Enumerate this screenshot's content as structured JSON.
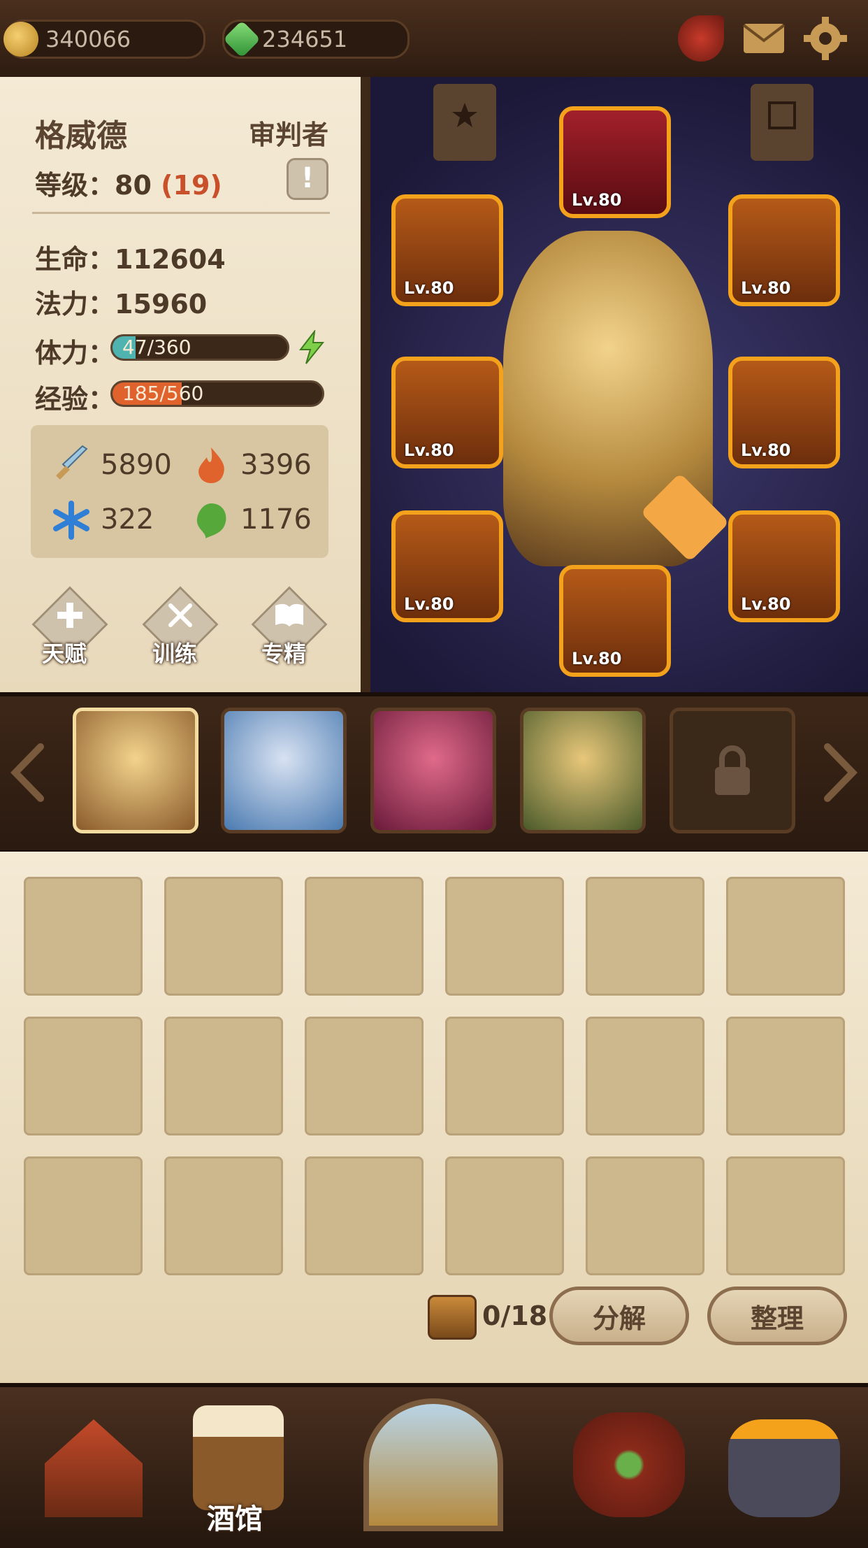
{
  "currency": {
    "gold": "340066",
    "gems": "234651"
  },
  "hero": {
    "name": "格威德",
    "class": "审判者",
    "level_label": "等级：",
    "level": "80",
    "level_bonus": "(19)",
    "hp_label": "生命：",
    "hp": "112604",
    "mp_label": "法力：",
    "mp": "15960",
    "stamina_label": "体力：",
    "stamina_text": "47/360",
    "stamina_fraction": 0.13,
    "exp_label": "经验：",
    "exp_text": "185/560",
    "exp_fraction": 0.33,
    "stats": {
      "attack": "5890",
      "fire": "3396",
      "ice": "322",
      "nature": "1176"
    }
  },
  "actions": {
    "talent": "天赋",
    "train": "训练",
    "mastery": "专精"
  },
  "equipment": [
    {
      "slot": "helmet",
      "level": "Lv.80"
    },
    {
      "slot": "amulet",
      "level": "Lv.80"
    },
    {
      "slot": "ring",
      "level": "Lv.80"
    },
    {
      "slot": "gloves",
      "level": "Lv.80"
    },
    {
      "slot": "armor",
      "level": "Lv.80"
    },
    {
      "slot": "weapon",
      "level": "Lv.80"
    },
    {
      "slot": "boots",
      "level": "Lv.80"
    },
    {
      "slot": "book",
      "level": "Lv.80"
    }
  ],
  "inventory": {
    "count": "0/18",
    "decompose": "分解",
    "sort": "整理"
  },
  "nav": {
    "tavern": "酒馆"
  },
  "colors": {
    "accent": "#f4a21b",
    "stamina": "#4fb3b0",
    "exp": "#e0622c",
    "bonus": "#c8502a"
  }
}
